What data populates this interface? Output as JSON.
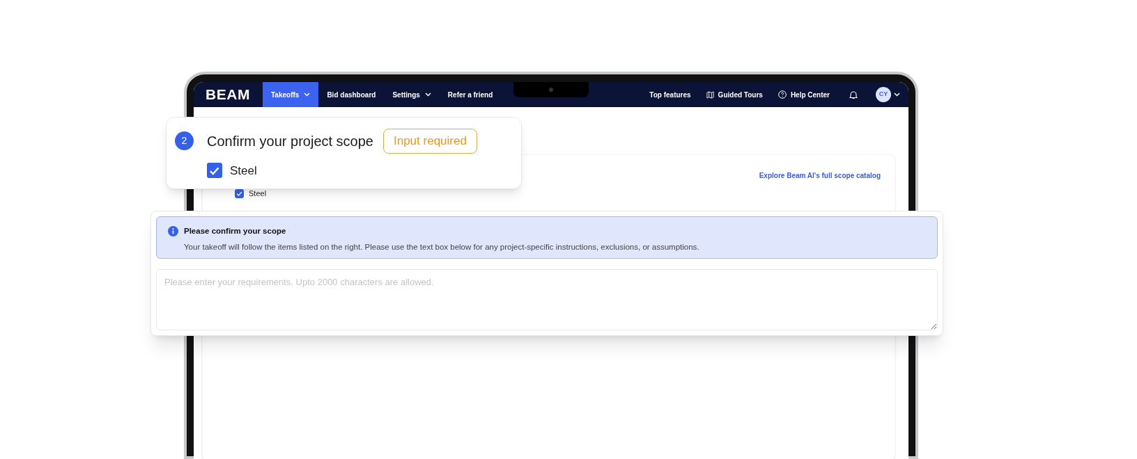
{
  "nav": {
    "logo": "BEAM",
    "items": [
      {
        "label": "Takeoffs",
        "selected": true,
        "dropdown": true
      },
      {
        "label": "Bid dashboard",
        "selected": false,
        "dropdown": false
      },
      {
        "label": "Settings",
        "selected": false,
        "dropdown": true
      },
      {
        "label": "Refer a friend",
        "selected": false,
        "dropdown": false
      }
    ],
    "right_items": [
      {
        "label": "Top features",
        "kind": "plain"
      },
      {
        "label": "Guided Tours",
        "kind": "map"
      },
      {
        "label": "Help Center",
        "kind": "help"
      }
    ],
    "avatar": "CY"
  },
  "background_card": {
    "link": "Explore Beam AI's full scope catalog",
    "items": [
      {
        "label": "Steel",
        "checked": true
      }
    ]
  },
  "step_card": {
    "step": "2",
    "title": "Confirm your project scope",
    "badge": "Input required",
    "items": [
      {
        "label": "Steel",
        "checked": true
      }
    ]
  },
  "requirements_card": {
    "notice_title": "Please confirm your scope",
    "notice_text": "Your takeoff will follow the items listed on the right. Please use the text box below for any project-specific instructions, exclusions, or assumptions.",
    "textarea": {
      "placeholder": "Please enter your requirements. Upto 2000 characters are allowed."
    }
  }
}
